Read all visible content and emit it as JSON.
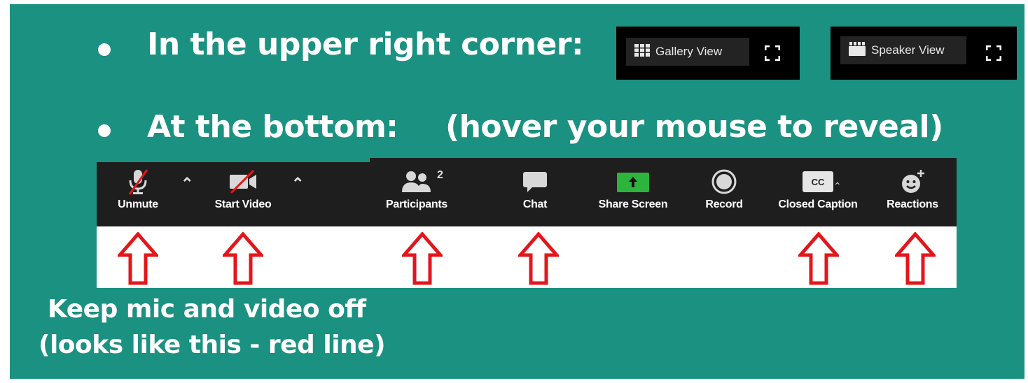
{
  "slide": {
    "line1": "In the upper right corner:",
    "line2": "At the bottom:",
    "line2_hint": "(hover your mouse to reveal)",
    "note_line1": "Keep mic and video off",
    "note_line2": "(looks like this - red line)"
  },
  "view_buttons": {
    "gallery": {
      "label": "Gallery View",
      "icon": "grid-icon"
    },
    "speaker": {
      "label": "Speaker View",
      "icon": "speaker-icon"
    }
  },
  "toolbar": {
    "unmute": "Unmute",
    "start_video": "Start Video",
    "participants": "Participants",
    "participants_count": "2",
    "chat": "Chat",
    "share_screen": "Share Screen",
    "record": "Record",
    "closed_caption": "Closed Caption",
    "cc_icon_text": "CC",
    "reactions": "Reactions"
  },
  "colors": {
    "slide_bg": "#1b9181",
    "toolbar_bg": "#1e1e1e",
    "arrow_red": "#e3161b",
    "share_green": "#2db43d"
  }
}
